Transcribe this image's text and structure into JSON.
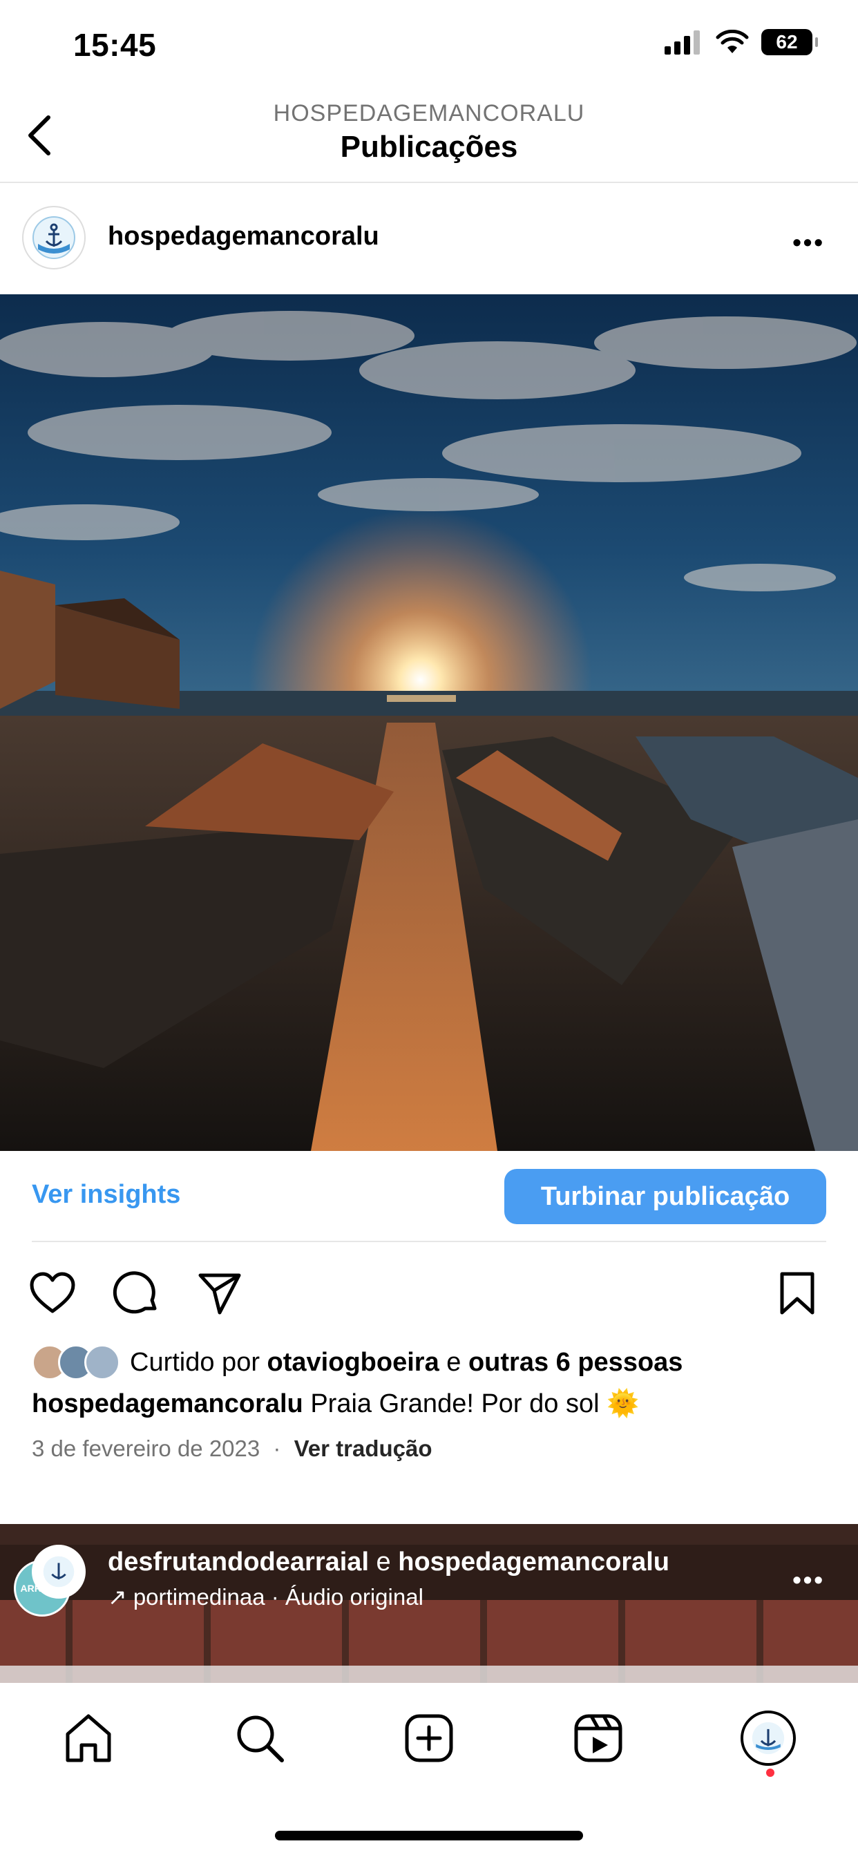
{
  "status": {
    "time": "15:45",
    "battery": "62"
  },
  "header": {
    "subtitle": "HOSPEDAGEMANCORALU",
    "title": "Publicações"
  },
  "post": {
    "username": "hospedagemancoralu",
    "insights_label": "Ver insights",
    "boost_label": "Turbinar publicação",
    "likes": {
      "prefix": "Curtido por ",
      "user": "otaviogboeira",
      "joiner": " e ",
      "others": "outras 6 pessoas"
    },
    "caption": {
      "username": "hospedagemancoralu",
      "text": " Praia Grande! Por do sol 🌞"
    },
    "date": "3 de fevereiro de 2023",
    "separator": "·",
    "translate_label": "Ver tradução"
  },
  "next_post": {
    "user1": "desfrutandodearraial",
    "joiner": " e ",
    "user2": "hospedagemancoralu",
    "audio_arrow": "↗",
    "audio_user": "portimedinaa",
    "audio_label": " · Áudio original"
  },
  "colors": {
    "accent": "#3897f0",
    "boost": "#4a9df2",
    "notification": "#ff3040"
  },
  "icons": [
    "back-icon",
    "more-icon",
    "heart-icon",
    "comment-icon",
    "share-icon",
    "bookmark-icon",
    "home-icon",
    "search-icon",
    "create-icon",
    "reels-icon",
    "profile-icon"
  ]
}
